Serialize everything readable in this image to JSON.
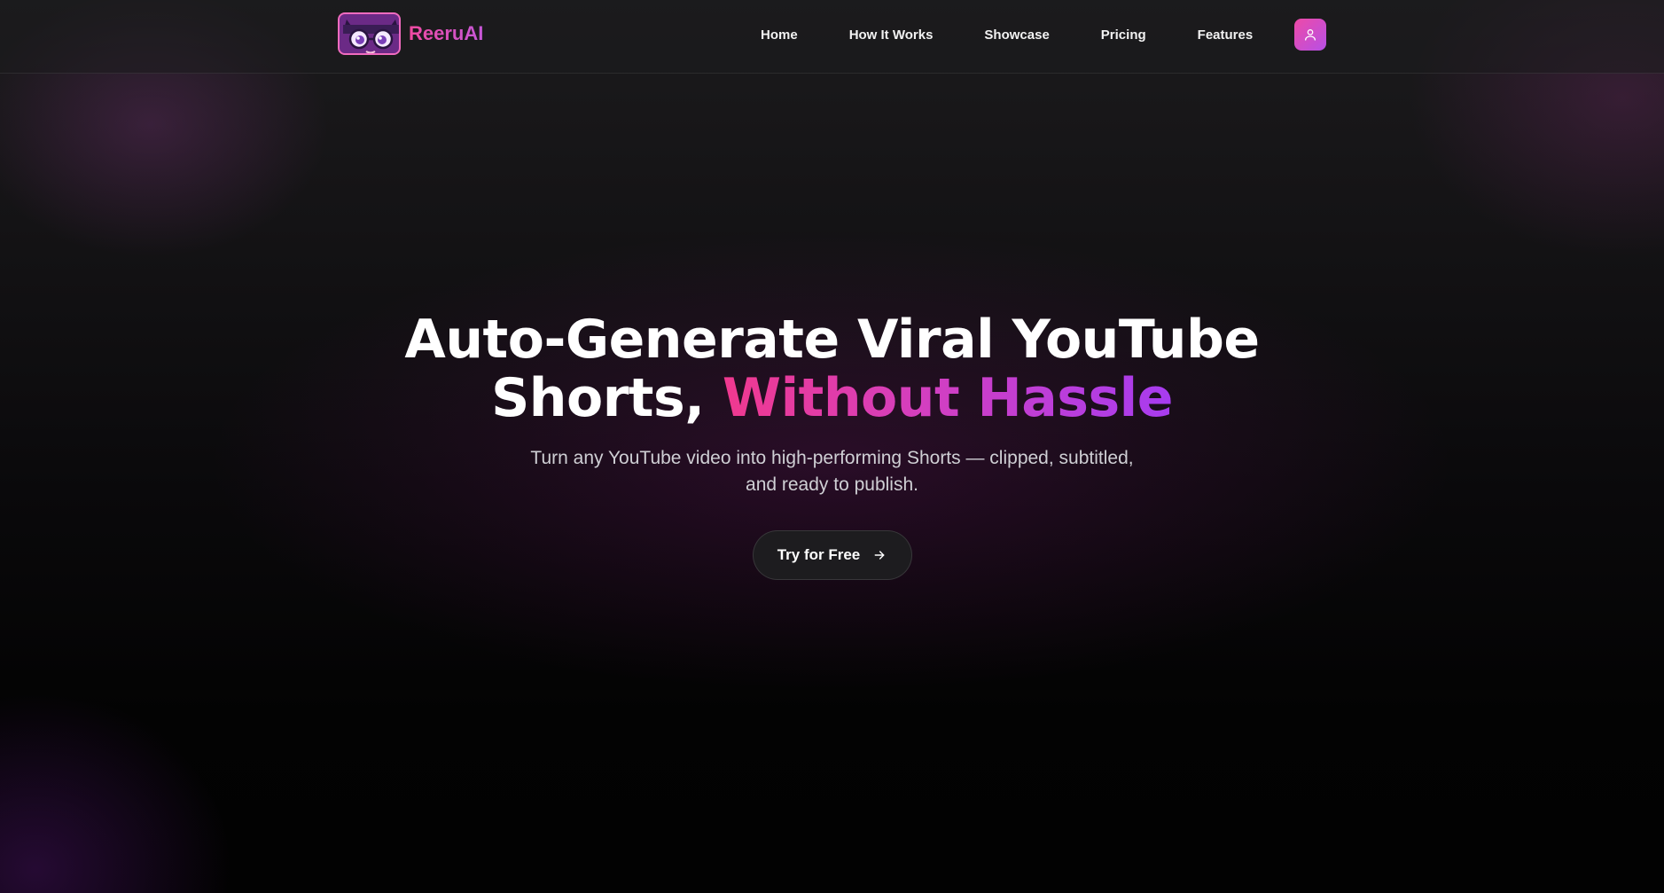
{
  "brand": {
    "name": "ReeruAI",
    "logo_icon": "anime-face-logo-icon"
  },
  "nav": {
    "links": [
      "Home",
      "How It Works",
      "Showcase",
      "Pricing",
      "Features"
    ],
    "user_icon": "user-icon"
  },
  "hero": {
    "headline_line1": "Auto-Generate Viral YouTube",
    "headline_line2_prefix": "Shorts, ",
    "headline_line2_accent": "Without Hassle",
    "subtitle": "Turn any YouTube video into high-performing Shorts — clipped, subtitled, and ready to publish.",
    "cta_label": "Try for Free",
    "cta_icon": "arrow-right-icon"
  },
  "colors": {
    "accent_pink": "#f0398f",
    "accent_purple": "#a73cf0",
    "background": "#0a090b"
  }
}
